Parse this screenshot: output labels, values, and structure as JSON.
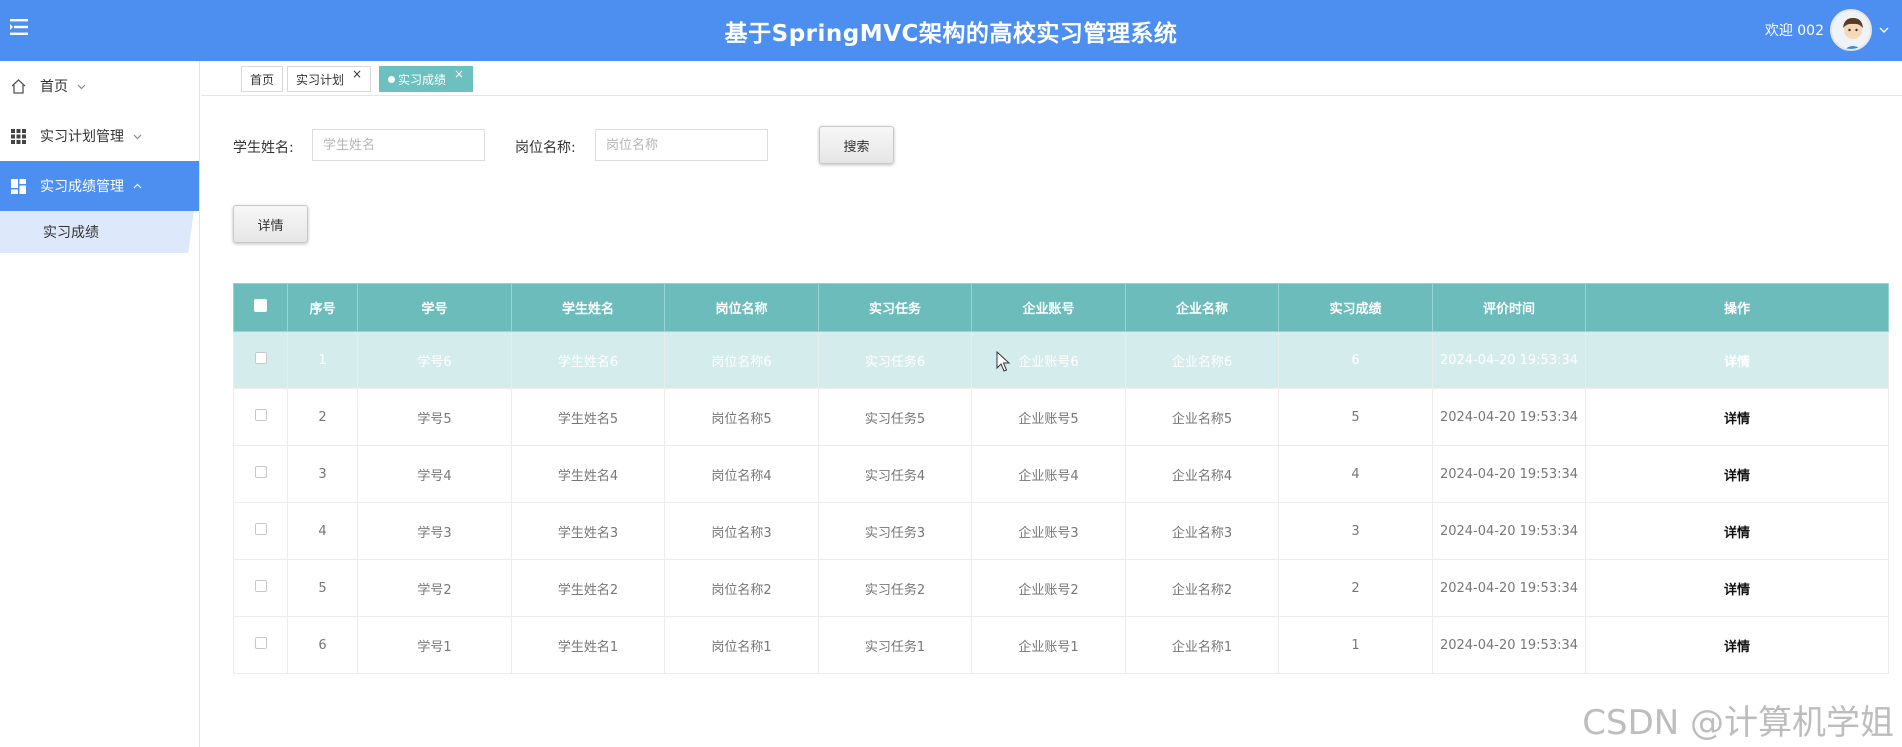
{
  "header": {
    "title": "基于SpringMVC架构的高校实习管理系统",
    "welcome": "欢迎 002",
    "bg_color": "#4d8ff0"
  },
  "sidebar": {
    "items": [
      {
        "label": "首页",
        "icon": "home-icon"
      },
      {
        "label": "实习计划管理",
        "icon": "grid-icon"
      },
      {
        "label": "实习成绩管理",
        "icon": "dashboard-icon"
      }
    ],
    "sub_item": "实习成绩"
  },
  "tabs": [
    {
      "label": "首页"
    },
    {
      "label": "实习计划",
      "close": "×"
    },
    {
      "label": "实习成绩",
      "close": "×"
    }
  ],
  "search": {
    "student_label": "学生姓名:",
    "student_placeholder": "学生姓名",
    "position_label": "岗位名称:",
    "position_placeholder": "岗位名称",
    "search_button": "搜索",
    "detail_button": "详情"
  },
  "table": {
    "columns": [
      "序号",
      "学号",
      "学生姓名",
      "岗位名称",
      "实习任务",
      "企业账号",
      "企业名称",
      "实习成绩",
      "评价时间",
      "操作"
    ],
    "rows": [
      [
        "1",
        "学号6",
        "学生姓名6",
        "岗位名称6",
        "实习任务6",
        "企业账号6",
        "企业名称6",
        "6",
        "2024-04-20 19:53:34",
        "详情"
      ],
      [
        "2",
        "学号5",
        "学生姓名5",
        "岗位名称5",
        "实习任务5",
        "企业账号5",
        "企业名称5",
        "5",
        "2024-04-20 19:53:34",
        "详情"
      ],
      [
        "3",
        "学号4",
        "学生姓名4",
        "岗位名称4",
        "实习任务4",
        "企业账号4",
        "企业名称4",
        "4",
        "2024-04-20 19:53:34",
        "详情"
      ],
      [
        "4",
        "学号3",
        "学生姓名3",
        "岗位名称3",
        "实习任务3",
        "企业账号3",
        "企业名称3",
        "3",
        "2024-04-20 19:53:34",
        "详情"
      ],
      [
        "5",
        "学号2",
        "学生姓名2",
        "岗位名称2",
        "实习任务2",
        "企业账号2",
        "企业名称2",
        "2",
        "2024-04-20 19:53:34",
        "详情"
      ],
      [
        "6",
        "学号1",
        "学生姓名1",
        "岗位名称1",
        "实习任务1",
        "企业账号1",
        "企业名称1",
        "1",
        "2024-04-20 19:53:34",
        "详情"
      ]
    ],
    "header_color": "#6cbcbc",
    "highlight_row_color": "#d5ecec"
  },
  "watermark": "CSDN @计算机学姐"
}
